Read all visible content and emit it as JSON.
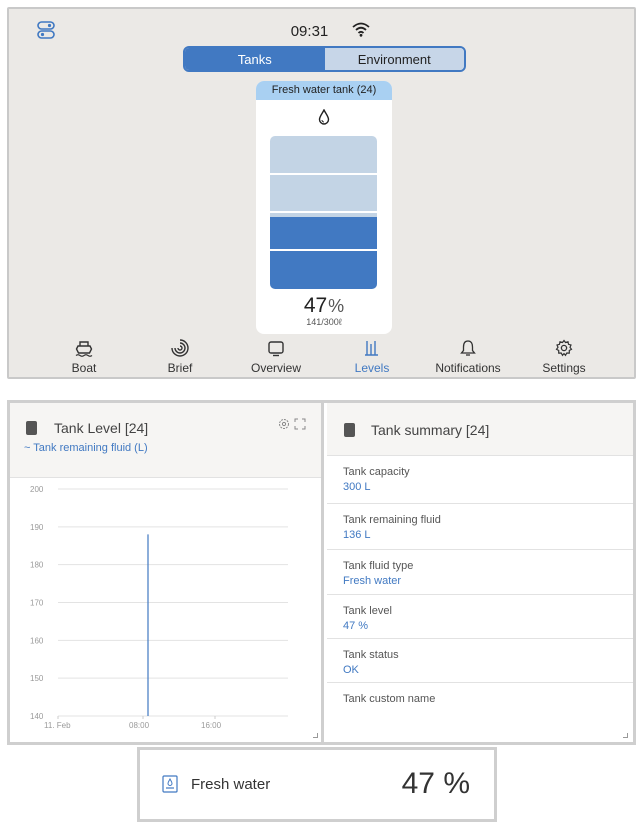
{
  "device": {
    "clock": "09:31",
    "tabs": [
      {
        "label": "Tanks",
        "active": true
      },
      {
        "label": "Environment",
        "active": false
      }
    ],
    "tank": {
      "title": "Fresh water tank (24)",
      "level_percent": 47,
      "percent_value": "47",
      "percent_unit": "%",
      "volume": "141/300ℓ"
    },
    "nav": [
      {
        "label": "Boat",
        "icon": "boat-icon"
      },
      {
        "label": "Brief",
        "icon": "brief-icon"
      },
      {
        "label": "Overview",
        "icon": "overview-icon"
      },
      {
        "label": "Levels",
        "icon": "levels-icon",
        "active": true
      },
      {
        "label": "Notifications",
        "icon": "bell-icon"
      },
      {
        "label": "Settings",
        "icon": "gear-icon"
      }
    ],
    "accent_color": "#4179c2"
  },
  "tank_level_panel": {
    "title": "Tank Level [24]",
    "legend": "Tank remaining fluid (L)"
  },
  "chart_data": {
    "type": "line",
    "title": "Tank Level [24]",
    "series": [
      {
        "name": "Tank remaining fluid (L)",
        "x": [
          "08:00",
          "08:00"
        ],
        "values": [
          140,
          188
        ]
      }
    ],
    "x_ticks": [
      "11. Feb",
      "08:00",
      "16:00"
    ],
    "y_ticks": [
      140,
      150,
      160,
      170,
      180,
      190,
      200
    ],
    "ylim": [
      140,
      200
    ],
    "grid": true,
    "color": "#4179c2"
  },
  "summary_panel": {
    "title": "Tank summary [24]",
    "rows": [
      {
        "label": "Tank capacity",
        "value": "300 L"
      },
      {
        "label": "Tank remaining fluid",
        "value": "136 L"
      },
      {
        "label": "Tank fluid type",
        "value": "Fresh water"
      },
      {
        "label": "Tank level",
        "value": "47 %"
      },
      {
        "label": "Tank status",
        "value": "OK"
      },
      {
        "label": "Tank custom name",
        "value": ""
      }
    ]
  },
  "tile": {
    "name": "Fresh water",
    "value": "47 %"
  }
}
